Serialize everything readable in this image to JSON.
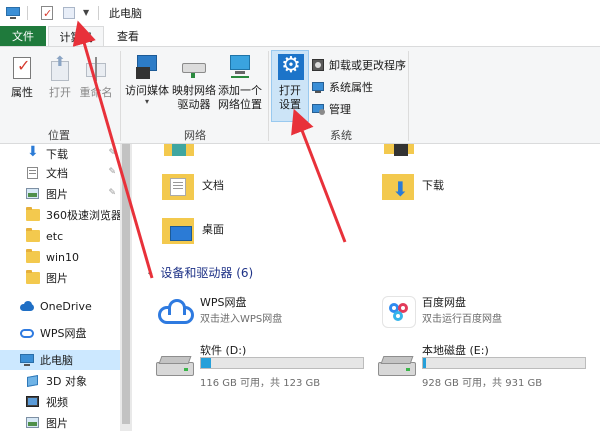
{
  "title": "此电脑",
  "tabs": {
    "file": "文件",
    "computer": "计算机",
    "view": "查看"
  },
  "ribbon": {
    "location": {
      "label": "位置",
      "properties": "属性",
      "open": "打开",
      "rename": "重命名"
    },
    "network": {
      "label": "网络",
      "media_line1": "访问媒体",
      "map_line1": "映射网络",
      "map_line2": "驱动器",
      "add_line1": "添加一个",
      "add_line2": "网络位置"
    },
    "system": {
      "label": "系统",
      "settings_line1": "打开",
      "settings_line2": "设置",
      "uninstall": "卸载或更改程序",
      "sys_props": "系统属性",
      "manage": "管理"
    }
  },
  "nav": {
    "downloads": "下载",
    "documents": "文档",
    "pictures": "图片",
    "folder_360": "360极速浏览器",
    "etc": "etc",
    "win10": "win10",
    "pictures2": "图片",
    "onedrive": "OneDrive",
    "wps": "WPS网盘",
    "this_pc": "此电脑",
    "objects3d": "3D 对象",
    "videos": "视频",
    "pictures3": "图片"
  },
  "content": {
    "folders": {
      "documents": "文档",
      "downloads": "下载",
      "desktop": "桌面"
    },
    "section_title": "设备和驱动器 (6)",
    "wps": {
      "name": "WPS网盘",
      "sub": "双击进入WPS网盘"
    },
    "baidu": {
      "name": "百度网盘",
      "sub": "双击运行百度网盘"
    },
    "drive_d": {
      "name": "软件 (D:)",
      "space": "116 GB 可用，共 123 GB",
      "used_fraction": 0.06
    },
    "drive_e": {
      "name": "本地磁盘 (E:)",
      "space": "928 GB 可用，共 931 GB",
      "used_fraction": 0.02
    }
  },
  "colors": {
    "file_tab": "#1f7a3c",
    "accent": "#26a0da",
    "selection": "#cce8ff",
    "arrow": "#e8313a"
  }
}
